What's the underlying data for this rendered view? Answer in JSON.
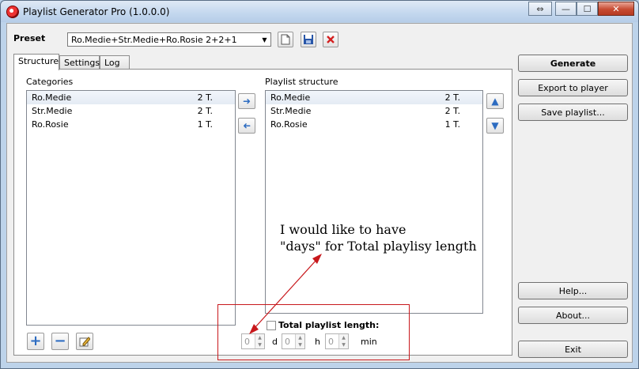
{
  "window": {
    "title": "Playlist Generator Pro (1.0.0.0)"
  },
  "titlebar_buttons": {
    "restore": "⇔",
    "minimize": "—",
    "maximize": "☐",
    "close": "✕"
  },
  "preset": {
    "label": "Preset",
    "value": "Ro.Medie+Str.Medie+Ro.Rosie 2+2+1"
  },
  "tabs": [
    {
      "label": "Structure"
    },
    {
      "label": "Settings"
    },
    {
      "label": "Log"
    }
  ],
  "categories": {
    "title": "Categories",
    "items": [
      {
        "name": "Ro.Medie",
        "count": "2 T."
      },
      {
        "name": "Str.Medie",
        "count": "2 T."
      },
      {
        "name": "Ro.Rosie",
        "count": "1 T."
      }
    ]
  },
  "structure": {
    "title": "Playlist structure",
    "items": [
      {
        "name": "Ro.Medie",
        "count": "2 T."
      },
      {
        "name": "Str.Medie",
        "count": "2 T."
      },
      {
        "name": "Ro.Rosie",
        "count": "1 T."
      }
    ]
  },
  "total_length": {
    "label": "Total playlist length:",
    "days_value": "0",
    "days_unit": "d",
    "hours_value": "0",
    "hours_unit": "h",
    "minutes_value": "0",
    "minutes_unit": "min"
  },
  "buttons": {
    "generate": "Generate",
    "export": "Export to player",
    "save": "Save playlist...",
    "help": "Help...",
    "about": "About...",
    "exit": "Exit"
  },
  "annotation": {
    "line1": "I would like to have",
    "line2": "\"days\" for Total playlisy length"
  },
  "colors": {
    "annotation_red": "#c8181c",
    "arrow_blue": "#2d6cc1"
  }
}
